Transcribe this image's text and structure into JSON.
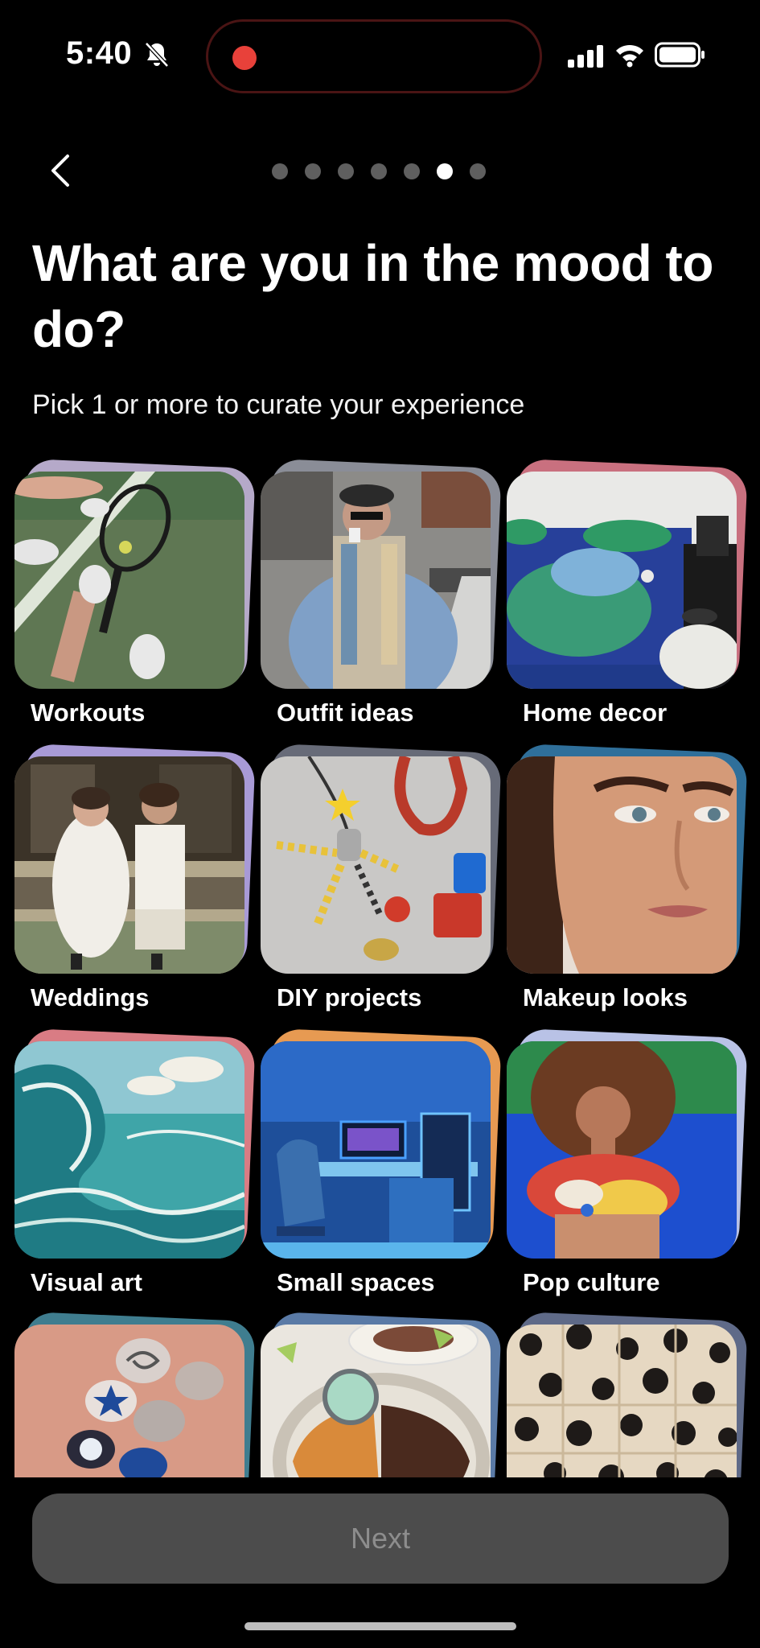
{
  "status_bar": {
    "time": "5:40"
  },
  "nav": {
    "step_count": 7,
    "current_step": 6
  },
  "header": {
    "title": "What are you in the mood to do?",
    "subtitle": "Pick 1 or more to curate your experience"
  },
  "topics": [
    {
      "label": "Workouts",
      "accent": "#b5a9c9"
    },
    {
      "label": "Outfit ideas",
      "accent": "#8a8d97"
    },
    {
      "label": "Home decor",
      "accent": "#c9707f"
    },
    {
      "label": "Weddings",
      "accent": "#a89ad6"
    },
    {
      "label": "DIY projects",
      "accent": "#676b78"
    },
    {
      "label": "Makeup looks",
      "accent": "#2f6f9a"
    },
    {
      "label": "Visual art",
      "accent": "#d97c84"
    },
    {
      "label": "Small spaces",
      "accent": "#e79a52"
    },
    {
      "label": "Pop culture",
      "accent": "#b9c2e6"
    },
    {
      "label": "",
      "accent": "#3f7d8f"
    },
    {
      "label": "",
      "accent": "#5a7aa6"
    },
    {
      "label": "",
      "accent": "#5f6a88"
    }
  ],
  "footer": {
    "next_label": "Next"
  }
}
